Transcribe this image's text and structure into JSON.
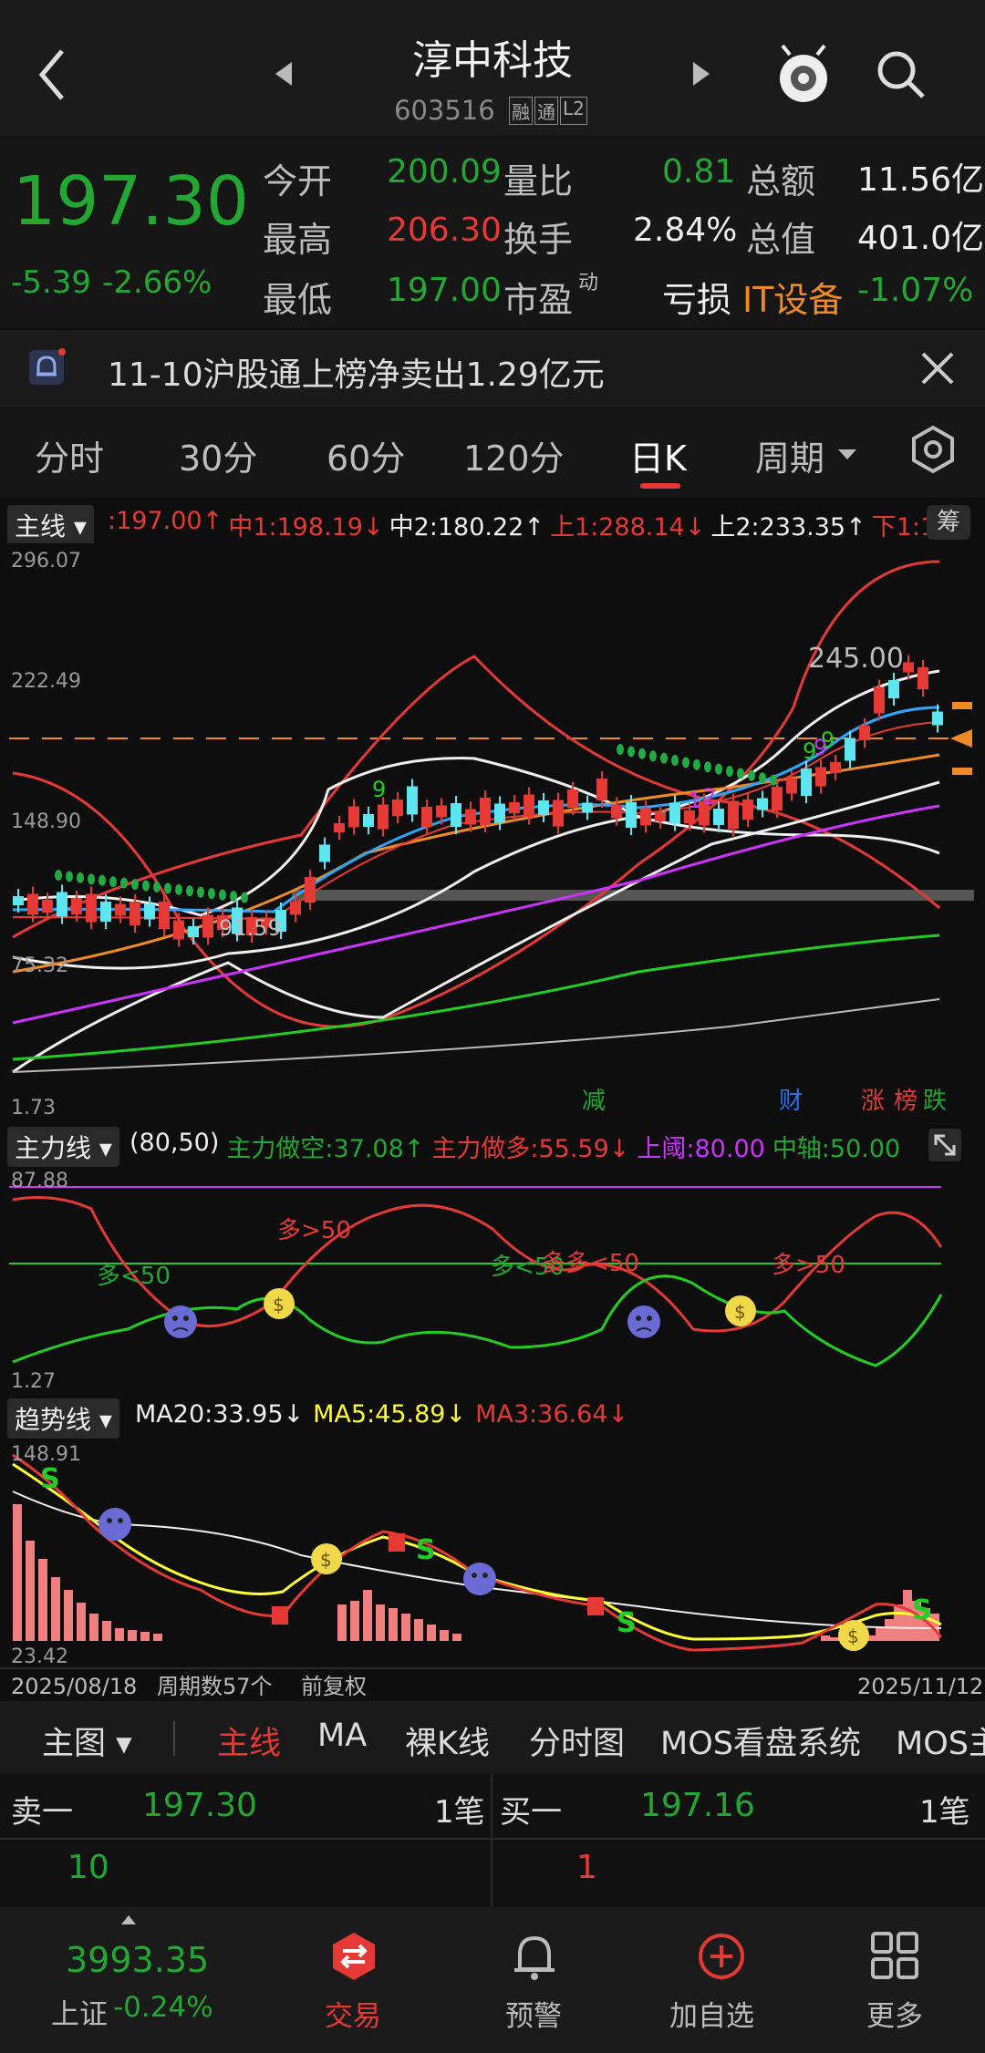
{
  "header": {
    "title": "淳中科技",
    "code": "603516",
    "badges": [
      "融",
      "通",
      "L2"
    ]
  },
  "quote": {
    "price": "197.30",
    "change": "-5.39",
    "change_pct": "-2.66%",
    "open_label": "今开",
    "open": "200.09",
    "high_label": "最高",
    "high": "206.30",
    "low_label": "最低",
    "low": "197.00",
    "vol_ratio_label": "量比",
    "vol_ratio": "0.81",
    "turnover_label": "换手",
    "turnover": "2.84%",
    "pe_label": "市盈",
    "pe_sup": "动",
    "pe": "亏损",
    "amount_label": "总额",
    "amount": "11.56亿",
    "mktcap_label": "总值",
    "mktcap": "401.0亿",
    "sector": "IT设备",
    "sector_pct": "-1.07%"
  },
  "notice": {
    "text": "11-10沪股通上榜净卖出1.29亿元"
  },
  "tabs": {
    "items": [
      "分时",
      "30分",
      "60分",
      "120分",
      "日K",
      "周期"
    ],
    "active": "日K"
  },
  "main_chart": {
    "selector": "主线",
    "legend": [
      {
        "text": ":197.00↑",
        "color": "#e53935"
      },
      {
        "text": "中1:198.19↓",
        "color": "#e53935"
      },
      {
        "text": "中2:180.22↑",
        "color": "#eeeeee"
      },
      {
        "text": "上1:288.14↓",
        "color": "#e53935"
      },
      {
        "text": "上2:233.35↑",
        "color": "#eeeeee"
      },
      {
        "text": "下1:1",
        "color": "#e53935"
      }
    ],
    "chip_btn": "筹",
    "y_labels": [
      "296.07",
      "222.49",
      "148.90",
      "75.32",
      "1.73"
    ],
    "peak_label": "245.00",
    "low_label": "91.59",
    "markers": [
      {
        "text": "减",
        "color": "#22a832"
      },
      {
        "text": "财",
        "color": "#2f6fe6"
      },
      {
        "text": "涨",
        "color": "#e53935"
      },
      {
        "text": "榜",
        "color": "#e53935"
      },
      {
        "text": "跌",
        "color": "#22a832"
      }
    ],
    "td_counts": [
      "9",
      "1",
      "2",
      "9",
      "9",
      "9"
    ]
  },
  "indicator1": {
    "selector": "主力线",
    "legend": [
      {
        "text": "(80,50)",
        "color": "#eeeeee"
      },
      {
        "text": "主力做空:37.08↑",
        "color": "#22a832"
      },
      {
        "text": "主力做多:55.59↓",
        "color": "#e53935"
      },
      {
        "text": "上阈:80.00",
        "color": "#cc33ff"
      },
      {
        "text": "中轴:50.00",
        "color": "#22a832"
      }
    ],
    "y_top": "87.88",
    "y_bottom": "1.27",
    "labels": [
      {
        "text": "多<50",
        "color": "#22a832"
      },
      {
        "text": "多>50",
        "color": "#e53935"
      },
      {
        "text": "多<50",
        "color": "#22a832"
      },
      {
        "text": "多多<50",
        "color": "#e53935"
      },
      {
        "text": "多>50",
        "color": "#e53935"
      }
    ]
  },
  "indicator2": {
    "selector": "趋势线",
    "legend": [
      {
        "text": "MA20:33.95↓",
        "color": "#eeeeee"
      },
      {
        "text": "MA5:45.89↓",
        "color": "#ffff33"
      },
      {
        "text": "MA3:36.64↓",
        "color": "#e53935"
      }
    ],
    "y_top": "148.91",
    "y_bottom": "23.42",
    "footer_left": "2025/08/18",
    "footer_count": "周期数57个",
    "footer_adj": "前复权",
    "footer_right": "2025/11/12"
  },
  "selector_bar": {
    "items": [
      "主图",
      "主线",
      "MA",
      "裸K线",
      "分时图",
      "MOS看盘系统",
      "MOS主"
    ],
    "active": "主线"
  },
  "order_book": {
    "sell_label": "卖一",
    "sell_price": "197.30",
    "sell_count": "1笔",
    "sell_vol": "10",
    "buy_label": "买一",
    "buy_price": "197.16",
    "buy_count": "1笔",
    "buy_vol": "1"
  },
  "bottom_nav": {
    "index_value": "3993.35",
    "index_name": "上证",
    "index_pct": "-0.24%",
    "items": [
      "交易",
      "预警",
      "加自选",
      "更多"
    ]
  },
  "colors": {
    "up": "#e53935",
    "down": "#22a832",
    "accent": "#f08a24",
    "bg": "#0e0e0e"
  }
}
